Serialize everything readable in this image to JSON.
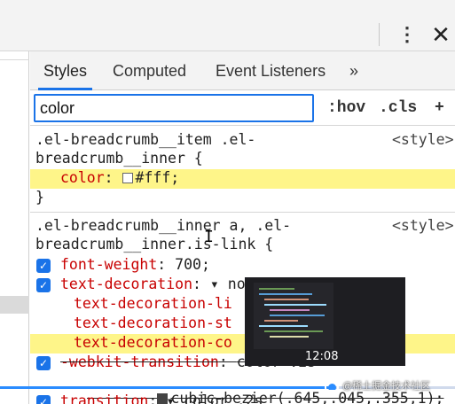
{
  "tabs": [
    {
      "label": "Styles"
    },
    {
      "label": "Computed"
    },
    {
      "label": "Event Listeners"
    }
  ],
  "more_tabs": "»",
  "filter": {
    "value": "color",
    "hov": ":hov",
    "cls": ".cls",
    "add": "+"
  },
  "rules": [
    {
      "selector_line1": ".el-breadcrumb__item .el-",
      "selector_line2": "breadcrumb__inner {",
      "source": "<style>",
      "props": [
        {
          "name": "color",
          "value": "#fff",
          "swatch": "#ffffff"
        }
      ],
      "close": "}"
    },
    {
      "selector_line1": ".el-breadcrumb__inner a, .el-",
      "selector_line2": "breadcrumb__inner.is-link {",
      "source": "<style>",
      "props": [
        {
          "name": "font-weight",
          "value": "700;"
        },
        {
          "name": "text-decoration",
          "value": "▾ no"
        },
        {
          "name": "text-decoration-li",
          "value": ""
        },
        {
          "name": "text-decoration-st",
          "value": ""
        },
        {
          "name": "text-decoration-co",
          "value": ""
        },
        {
          "name": "-webkit-transition",
          "value": "color .2s"
        },
        {
          "name": "cubic-bezier(.645,.045,.355,1);",
          "value": ""
        },
        {
          "name": "transition",
          "value": "▾ color .2s"
        }
      ]
    }
  ],
  "video": {
    "time": "12:08",
    "progress": 0.73
  },
  "watermark": "@稀土掘金技术社区"
}
